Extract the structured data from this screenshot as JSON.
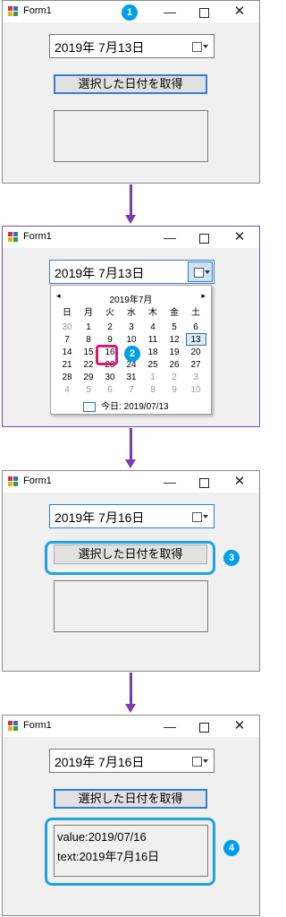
{
  "colors": {
    "accent": "#1fa2e1",
    "badge": "#00a0e9",
    "pink": "#e0156f",
    "arrow": "#7a3ab0"
  },
  "window": {
    "title": "Form1",
    "minimize": "—",
    "maximize": "☐",
    "close": "✕"
  },
  "button_label": "選択した日付を取得",
  "steps": [
    {
      "badge": "1",
      "date_text": "2019年  7月13日",
      "lines": []
    },
    {
      "badge": "2",
      "date_text": "2019年  7月13日",
      "lines": []
    },
    {
      "badge": "3",
      "date_text": "2019年  7月16日",
      "lines": []
    },
    {
      "badge": "4",
      "date_text": "2019年  7月16日",
      "lines": [
        "value:2019/07/16",
        "text:2019年7月16日"
      ]
    }
  ],
  "calendar": {
    "month_label": "2019年7月",
    "prev": "◂",
    "next": "▸",
    "weekdays": [
      "日",
      "月",
      "火",
      "水",
      "木",
      "金",
      "土"
    ],
    "weeks": [
      [
        [
          "30",
          true
        ],
        [
          "1",
          false
        ],
        [
          "2",
          false
        ],
        [
          "3",
          false
        ],
        [
          "4",
          false
        ],
        [
          "5",
          false
        ],
        [
          "6",
          false
        ]
      ],
      [
        [
          "7",
          false
        ],
        [
          "8",
          false
        ],
        [
          "9",
          false
        ],
        [
          "10",
          false
        ],
        [
          "11",
          false
        ],
        [
          "12",
          false
        ],
        [
          "13",
          false
        ]
      ],
      [
        [
          "14",
          false
        ],
        [
          "15",
          false
        ],
        [
          "16",
          false
        ],
        [
          "17",
          false
        ],
        [
          "18",
          false
        ],
        [
          "19",
          false
        ],
        [
          "20",
          false
        ]
      ],
      [
        [
          "21",
          false
        ],
        [
          "22",
          false
        ],
        [
          "23",
          false
        ],
        [
          "24",
          false
        ],
        [
          "25",
          false
        ],
        [
          "26",
          false
        ],
        [
          "27",
          false
        ]
      ],
      [
        [
          "28",
          false
        ],
        [
          "29",
          false
        ],
        [
          "30",
          false
        ],
        [
          "31",
          false
        ],
        [
          "1",
          true
        ],
        [
          "2",
          true
        ],
        [
          "3",
          true
        ]
      ],
      [
        [
          "4",
          true
        ],
        [
          "5",
          true
        ],
        [
          "6",
          true
        ],
        [
          "7",
          true
        ],
        [
          "8",
          true
        ],
        [
          "9",
          true
        ],
        [
          "10",
          true
        ]
      ]
    ],
    "today_label": "今日: 2019/07/13"
  }
}
